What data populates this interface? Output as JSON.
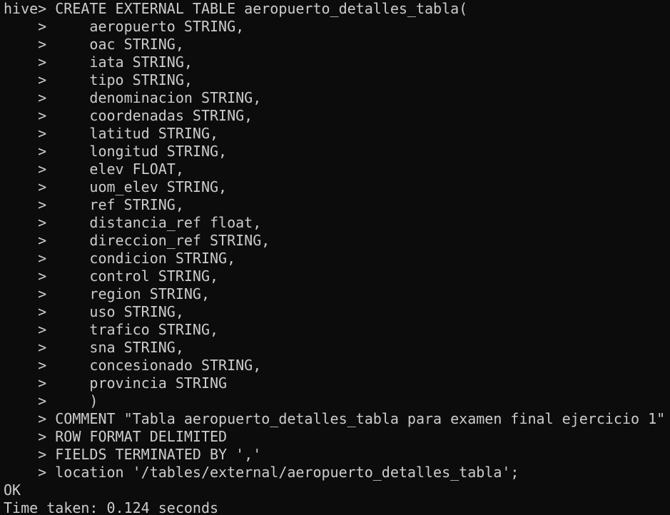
{
  "terminal": {
    "lines": [
      "hive> CREATE EXTERNAL TABLE aeropuerto_detalles_tabla(",
      "    >     aeropuerto STRING,",
      "    >     oac STRING,",
      "    >     iata STRING,",
      "    >     tipo STRING,",
      "    >     denominacion STRING,",
      "    >     coordenadas STRING,",
      "    >     latitud STRING,",
      "    >     longitud STRING,",
      "    >     elev FLOAT,",
      "    >     uom_elev STRING,",
      "    >     ref STRING,",
      "    >     distancia_ref float,",
      "    >     direccion_ref STRING,",
      "    >     condicion STRING,",
      "    >     control STRING,",
      "    >     region STRING,",
      "    >     uso STRING,",
      "    >     trafico STRING,",
      "    >     sna STRING,",
      "    >     concesionado STRING,",
      "    >     provincia STRING",
      "    >     )",
      "    > COMMENT \"Tabla aeropuerto_detalles_tabla para examen final ejercicio 1\"",
      "    > ROW FORMAT DELIMITED",
      "    > FIELDS TERMINATED BY ','",
      "    > location '/tables/external/aeropuerto_detalles_tabla';",
      "OK",
      "Time taken: 0.124 seconds"
    ]
  },
  "colors": {
    "background": "#0c0c0c",
    "text": "#cccccc"
  }
}
